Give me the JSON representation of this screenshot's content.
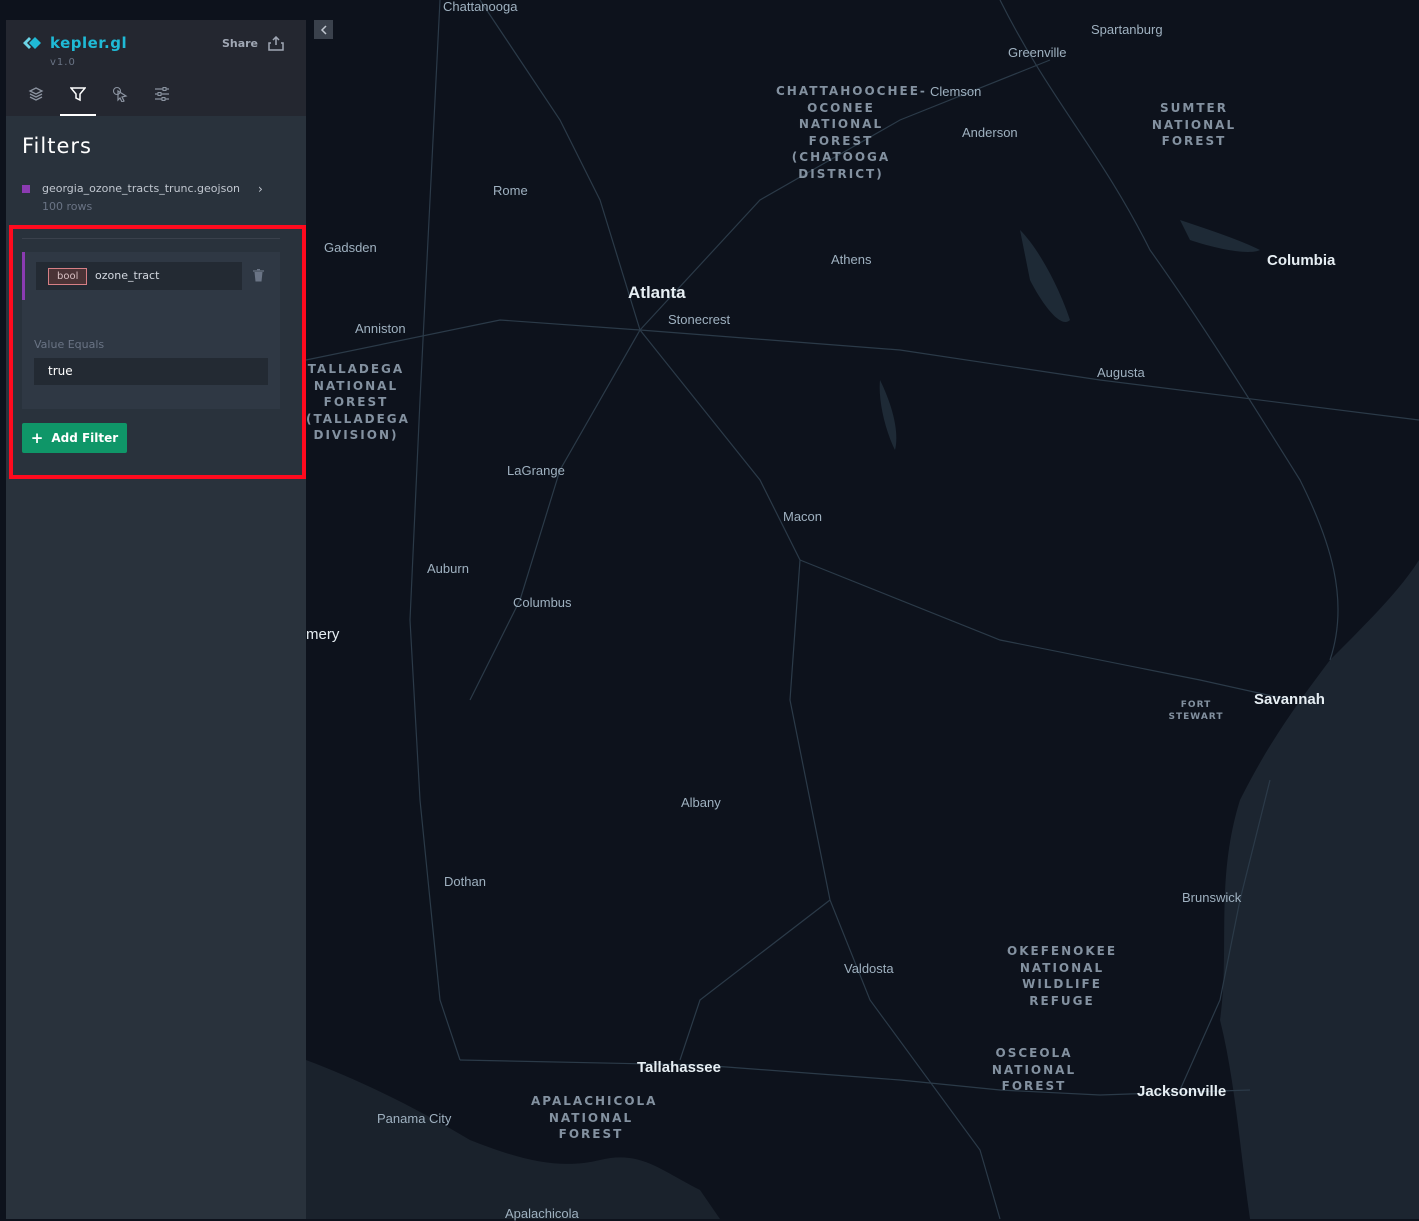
{
  "app": {
    "name": "kepler.gl",
    "version": "v1.0",
    "share_label": "Share"
  },
  "tabs": [
    {
      "name": "layers",
      "icon": "layers-icon",
      "active": false
    },
    {
      "name": "filters",
      "icon": "filter-icon",
      "active": true
    },
    {
      "name": "interactions",
      "icon": "cursor-click-icon",
      "active": false
    },
    {
      "name": "map-style",
      "icon": "sliders-icon",
      "active": false
    }
  ],
  "panel": {
    "title": "Filters",
    "dataset": {
      "name": "georgia_ozone_tracts_trunc.geojson",
      "rows": "100 rows",
      "color": "#8b3bb2"
    },
    "filter": {
      "type": "bool",
      "field": "ozone_tract",
      "value_label": "Value Equals",
      "value": "true"
    },
    "add_filter_label": "Add Filter"
  },
  "colors": {
    "accent": "#1fbad6",
    "button": "#0f9668",
    "highlight": "#ff0a1e",
    "panel": "#29323c",
    "map": "#0d121c"
  },
  "map": {
    "labels": {
      "chattanooga": "Chattanooga",
      "spartanburg": "Spartanburg",
      "greenville": "Greenville",
      "clemson": "Clemson",
      "anderson": "Anderson",
      "rome": "Rome",
      "gadsden": "Gadsden",
      "athens": "Athens",
      "atlanta": "Atlanta",
      "stonecrest": "Stonecrest",
      "columbia": "Columbia",
      "anniston": "Anniston",
      "augusta": "Augusta",
      "lagrange": "LaGrange",
      "macon": "Macon",
      "auburn": "Auburn",
      "columbus": "Columbus",
      "montgomery": "mery",
      "savannah": "Savannah",
      "albany": "Albany",
      "dothan": "Dothan",
      "brunswick": "Brunswick",
      "valdosta": "Valdosta",
      "tallahassee": "Tallahassee",
      "jacksonville": "Jacksonville",
      "panama_city": "Panama City",
      "apalachicola": "Apalachicola"
    },
    "parks": {
      "chattahoochee": [
        "CHATTAHOOCHEE-",
        "OCONEE",
        "NATIONAL",
        "FOREST",
        "(CHATOOGA",
        "DISTRICT)"
      ],
      "sumter": [
        "SUMTER",
        "NATIONAL",
        "FOREST"
      ],
      "talladega": [
        "TALLADEGA",
        "NATIONAL",
        "FOREST",
        "(TALLADEGA",
        "DIVISION)"
      ],
      "fort_stewart": [
        "FORT",
        "STEWART"
      ],
      "okefenokee": [
        "OKEFENOKEE",
        "NATIONAL",
        "WILDLIFE",
        "REFUGE"
      ],
      "osceola": [
        "OSCEOLA",
        "NATIONAL",
        "FOREST"
      ],
      "apalachicola_nf": [
        "APALACHICOLA",
        "NATIONAL",
        "FOREST"
      ]
    }
  }
}
